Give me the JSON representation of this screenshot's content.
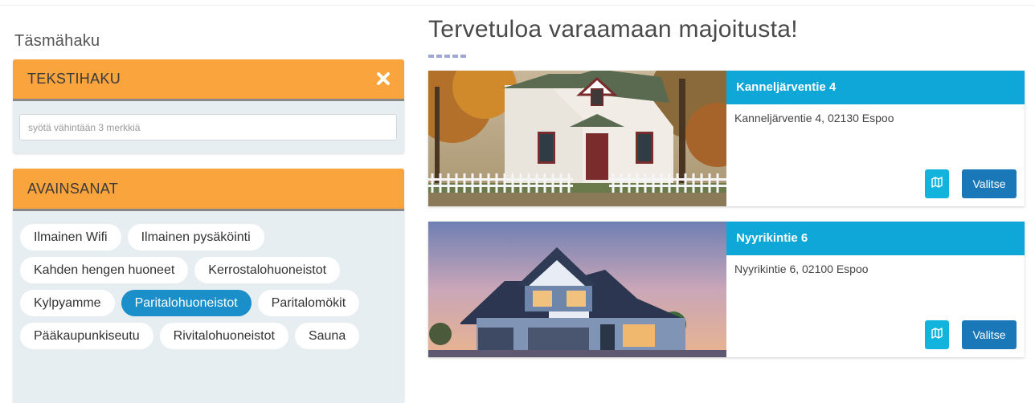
{
  "sidebar": {
    "heading": "Täsmähaku",
    "text_search": {
      "title": "TEKSTIHAKU",
      "close_icon": "close-icon",
      "input_value": "",
      "input_placeholder": "syötä vähintään 3 merkkiä"
    },
    "keywords": {
      "title": "AVAINSANAT",
      "tags": [
        {
          "label": "Ilmainen Wifi",
          "active": false
        },
        {
          "label": "Ilmainen pysäköinti",
          "active": false
        },
        {
          "label": "Kahden hengen huoneet",
          "active": false
        },
        {
          "label": "Kerrostalohuoneistot",
          "active": false
        },
        {
          "label": "Kylpyamme",
          "active": false
        },
        {
          "label": "Paritalohuoneistot",
          "active": true
        },
        {
          "label": "Paritalomökit",
          "active": false
        },
        {
          "label": "Pääkaupunkiseutu",
          "active": false
        },
        {
          "label": "Rivitalohuoneistot",
          "active": false
        },
        {
          "label": "Sauna",
          "active": false
        }
      ]
    }
  },
  "main": {
    "title": "Tervetuloa varaamaan majoitusta!",
    "listings": [
      {
        "name": "Kanneljärventie 4",
        "address": "Kanneljärventie 4, 02130 Espoo",
        "map_icon": "map-icon",
        "select_label": "Valitse"
      },
      {
        "name": "Nyyrikintie 6",
        "address": "Nyyrikintie 6, 02100 Espoo",
        "map_icon": "map-icon",
        "select_label": "Valitse"
      }
    ]
  },
  "colors": {
    "panel_header": "#f9a43c",
    "panel_body": "#e6eef2",
    "tag_active": "#1a8fc9",
    "card_title": "#0fa6d8",
    "map_button": "#12b4dd",
    "select_button": "#1a78b8"
  }
}
